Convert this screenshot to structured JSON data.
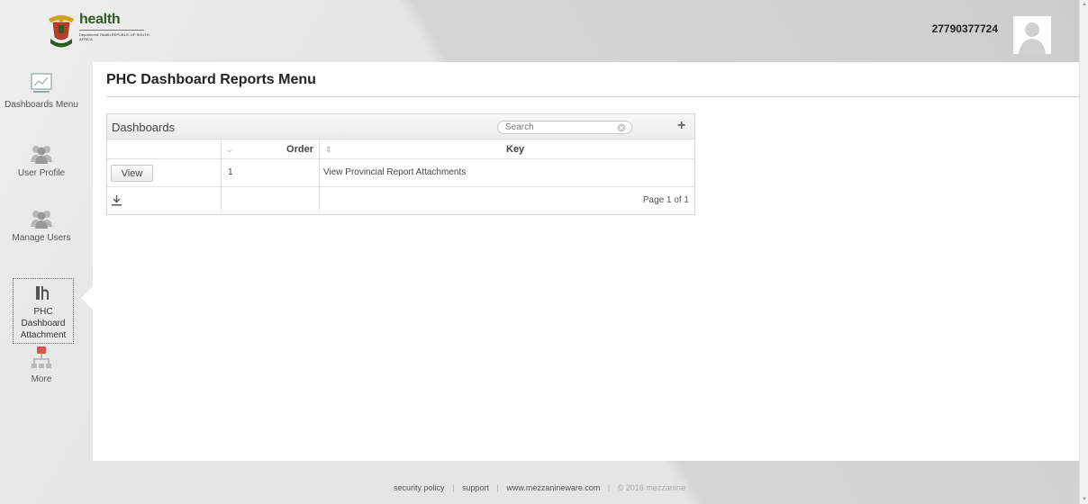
{
  "header": {
    "logo": {
      "title": "health",
      "sub": "Department: Health REPUBLIC OF SOUTH AFRICA"
    },
    "user_id": "27790377724"
  },
  "sidebar": {
    "items": [
      {
        "label": "Dashboards Menu",
        "icon": "chart-icon"
      },
      {
        "label": "User Profile",
        "icon": "users-icon"
      },
      {
        "label": "Manage Users",
        "icon": "users-icon"
      },
      {
        "label": "PHC Dashboard Attachment",
        "icon": "report-icon",
        "active": true
      },
      {
        "label": "More",
        "icon": "sitemap-icon"
      }
    ]
  },
  "main": {
    "page_title": "PHC Dashboard Reports Menu",
    "grid": {
      "title": "Dashboards",
      "search_placeholder": "Search",
      "add_label": "+",
      "columns": [
        "Order",
        "Key"
      ],
      "rows": [
        {
          "action": "View",
          "order": "1",
          "key": "View Provincial Report Attachments"
        }
      ],
      "pager": "Page 1 of 1"
    }
  },
  "footer": {
    "links": [
      "security policy",
      "support",
      "www.mezzanineware.com"
    ],
    "separator": "|",
    "copyright": "© 2016 mezzanine"
  },
  "colors": {
    "brand_green": "#2c5d1e",
    "accent_red": "#d9534f"
  }
}
